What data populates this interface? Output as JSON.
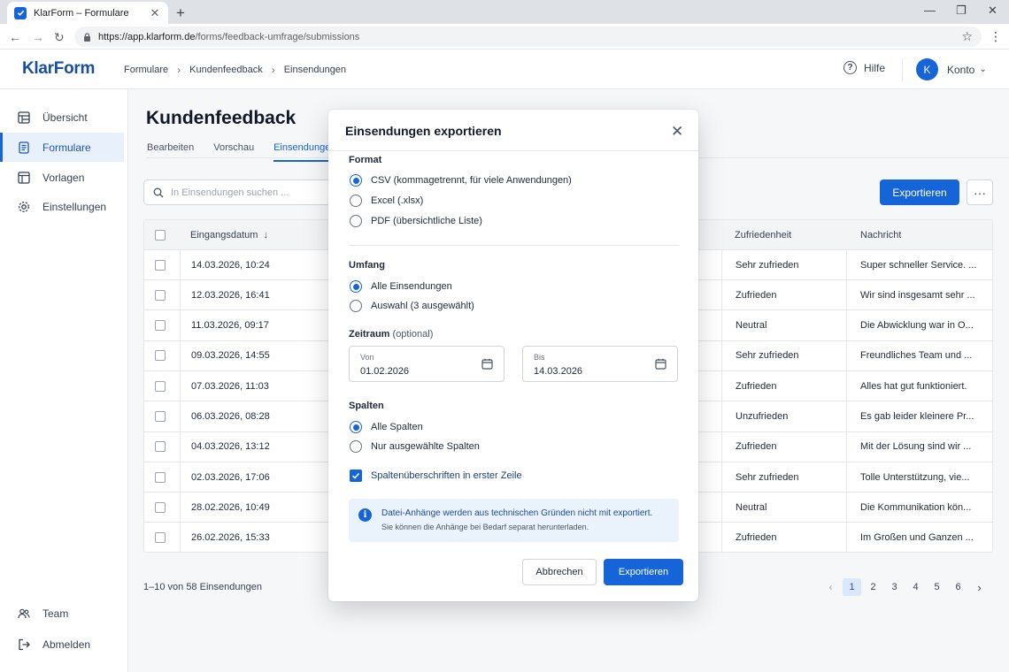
{
  "browser": {
    "tab_title": "KlarForm – Formulare",
    "url_host": "https://app.klarform.de",
    "url_path": "/forms/feedback-umfrage/submissions"
  },
  "header": {
    "logo": "KlarForm",
    "breadcrumb": [
      "Formulare",
      "Kundenfeedback",
      "Einsendungen"
    ],
    "help_label": "Hilfe",
    "avatar_initial": "K",
    "account_label": "Konto"
  },
  "sidebar": {
    "items": [
      {
        "label": "Übersicht",
        "icon": "dashboard-icon"
      },
      {
        "label": "Formulare",
        "icon": "form-icon",
        "active": true
      },
      {
        "label": "Vorlagen",
        "icon": "template-icon"
      },
      {
        "label": "Einstellungen",
        "icon": "gear-icon"
      }
    ],
    "bottom": [
      {
        "label": "Team",
        "icon": "users-icon"
      },
      {
        "label": "Abmelden",
        "icon": "logout-icon"
      }
    ]
  },
  "main": {
    "title": "Kundenfeedback",
    "tabs": [
      "Bearbeiten",
      "Vorschau",
      "Einsendungen"
    ],
    "search_placeholder": "In Einsendungen suchen ...",
    "export_label": "Exportieren",
    "table": {
      "headers": {
        "date": "Eingangsdatum",
        "satisfaction": "Zufriedenheit",
        "message": "Nachricht"
      },
      "rows": [
        {
          "date": "14.03.2026, 10:24",
          "satisfaction": "Sehr zufrieden",
          "message": "Super schneller Service. ..."
        },
        {
          "date": "12.03.2026, 16:41",
          "satisfaction": "Zufrieden",
          "message": "Wir sind insgesamt sehr ..."
        },
        {
          "date": "11.03.2026, 09:17",
          "satisfaction": "Neutral",
          "message": "Die Abwicklung war in O..."
        },
        {
          "date": "09.03.2026, 14:55",
          "satisfaction": "Sehr zufrieden",
          "message": "Freundliches Team und ..."
        },
        {
          "date": "07.03.2026, 11:03",
          "satisfaction": "Zufrieden",
          "message": "Alles hat gut funktioniert."
        },
        {
          "date": "06.03.2026, 08:28",
          "satisfaction": "Unzufrieden",
          "message": "Es gab leider kleinere Pr..."
        },
        {
          "date": "04.03.2026, 13:12",
          "satisfaction": "Zufrieden",
          "message": "Mit der Lösung sind wir ..."
        },
        {
          "date": "02.03.2026, 17:06",
          "satisfaction": "Sehr zufrieden",
          "message": "Tolle Unterstützung, vie..."
        },
        {
          "date": "28.02.2026, 10:49",
          "satisfaction": "Neutral",
          "message": "Die Kommunikation kön..."
        },
        {
          "date": "26.02.2026, 15:33",
          "satisfaction": "Zufrieden",
          "message": "Im Großen und Ganzen ..."
        }
      ]
    },
    "pager_text": "1–10 von 58 Einsendungen",
    "pages": [
      "1",
      "2",
      "3",
      "4",
      "5",
      "6"
    ],
    "current_page": "1"
  },
  "modal": {
    "title": "Einsendungen exportieren",
    "format_label": "Format",
    "format_options": [
      "CSV (kommagetrennt, für viele Anwendungen)",
      "Excel (.xlsx)",
      "PDF (übersichtliche Liste)"
    ],
    "scope_label": "Umfang",
    "scope_options": [
      "Alle Einsendungen",
      "Auswahl (3 ausgewählt)"
    ],
    "period_label": "Zeitraum",
    "period_optional": "(optional)",
    "from_label": "Von",
    "from_value": "01.02.2026",
    "to_label": "Bis",
    "to_value": "14.03.2026",
    "columns_label": "Spalten",
    "columns_options": [
      "Alle Spalten",
      "Nur ausgewählte Spalten"
    ],
    "header_row_label": "Spaltenüberschriften in erster Zeile",
    "info_line1": "Datei-Anhänge werden aus technischen Gründen nicht mit exportiert.",
    "info_line2": "Sie können die Anhänge bei Bedarf separat herunterladen.",
    "cancel_label": "Abbrechen",
    "export_label": "Exportieren"
  },
  "colors": {
    "accent": "#1565d8",
    "brand": "#1a4fa0"
  }
}
